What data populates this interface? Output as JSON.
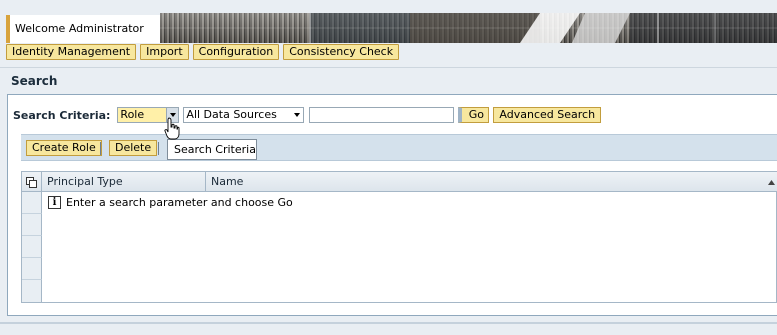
{
  "header": {
    "welcome": "Welcome Administrator"
  },
  "nav": {
    "items": [
      {
        "label": "Identity Management"
      },
      {
        "label": "Import"
      },
      {
        "label": "Configuration"
      },
      {
        "label": "Consistency Check"
      }
    ]
  },
  "section": {
    "title": "Search"
  },
  "criteria": {
    "label": "Search Criteria:",
    "role_value": "Role",
    "source_value": "All Data Sources",
    "search_value": "",
    "go_label": "Go",
    "advanced_label": "Advanced Search"
  },
  "toolbar": {
    "create_role": "Create Role",
    "delete": "Delete"
  },
  "tooltip": {
    "text": "Search Criteria"
  },
  "table": {
    "columns": [
      "Principal Type",
      "Name"
    ],
    "empty_message": "Enter a search parameter and choose Go"
  },
  "colors": {
    "button_fill": "#f7e79e",
    "button_border": "#c29d3d",
    "toolbar_bg": "#d4e1ec",
    "highlight_select": "#fff0a8"
  }
}
